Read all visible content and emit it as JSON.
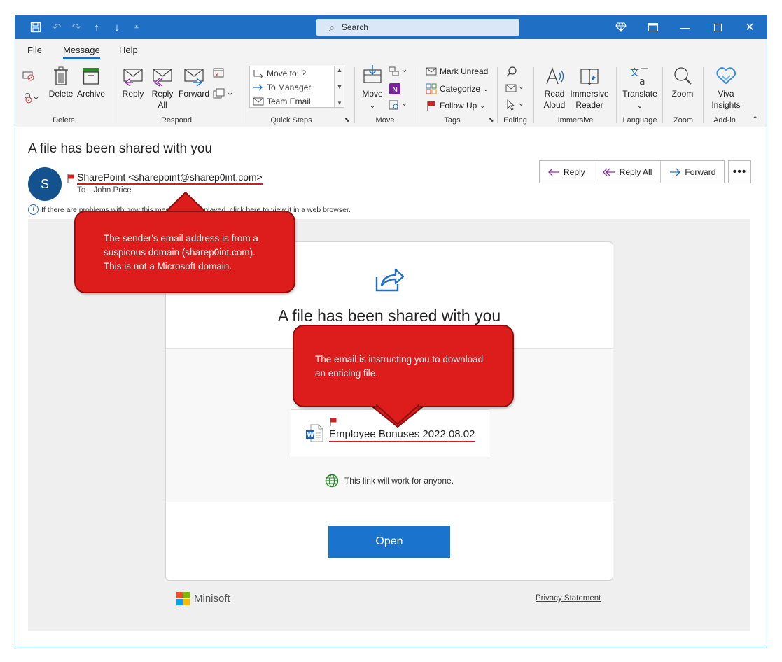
{
  "titlebar": {
    "search_placeholder": "Search"
  },
  "menu": {
    "tabs": [
      "File",
      "Message",
      "Help"
    ],
    "active": "Message"
  },
  "ribbon": {
    "delete_label": "Delete",
    "archive_label": "Archive",
    "reply_label": "Reply",
    "reply_all_label_1": "Reply",
    "reply_all_label_2": "All",
    "forward_label": "Forward",
    "quick_steps": [
      "Move to: ?",
      "To Manager",
      "Team Email"
    ],
    "move_label": "Move",
    "mark_unread_label": "Mark Unread",
    "categorize_label": "Categorize",
    "follow_up_label": "Follow Up",
    "read_aloud_label_1": "Read",
    "read_aloud_label_2": "Aloud",
    "immersive_reader_label_1": "Immersive",
    "immersive_reader_label_2": "Reader",
    "translate_label": "Translate",
    "zoom_label": "Zoom",
    "viva_label_1": "Viva",
    "viva_label_2": "Insights",
    "groups": [
      "Delete",
      "Respond",
      "Quick Steps",
      "Move",
      "Tags",
      "Editing",
      "Immersive",
      "Language",
      "Zoom",
      "Add-in"
    ]
  },
  "message": {
    "subject": "A file has been shared with you",
    "avatar_initial": "S",
    "sender": "SharePoint <sharepoint@sharep0int.com>",
    "to_key": "To",
    "to_value": "John Price",
    "info_text": "If there are problems with how this message is displayed, click here to view it in a web browser.",
    "actions": {
      "reply": "Reply",
      "reply_all": "Reply All",
      "forward": "Forward"
    }
  },
  "email_body": {
    "card_title": "A file has been shared with you",
    "file_name": "Employee Bonuses 2022.08.02",
    "link_note": "This link will work for anyone.",
    "open_button": "Open",
    "brand": "Minisoft",
    "privacy": "Privacy Statement"
  },
  "callouts": {
    "sender_warning_1": "The sender's email address is from a",
    "sender_warning_2": "suspicous domain (sharep0int.com).",
    "sender_warning_3": "This is not a Microsoft domain.",
    "download_warning_1": "The email is instructing you to download",
    "download_warning_2": "an enticing file."
  },
  "colors": {
    "accent": "#1f6fc5",
    "callout": "#dd1c1c",
    "button": "#1a73cc"
  }
}
